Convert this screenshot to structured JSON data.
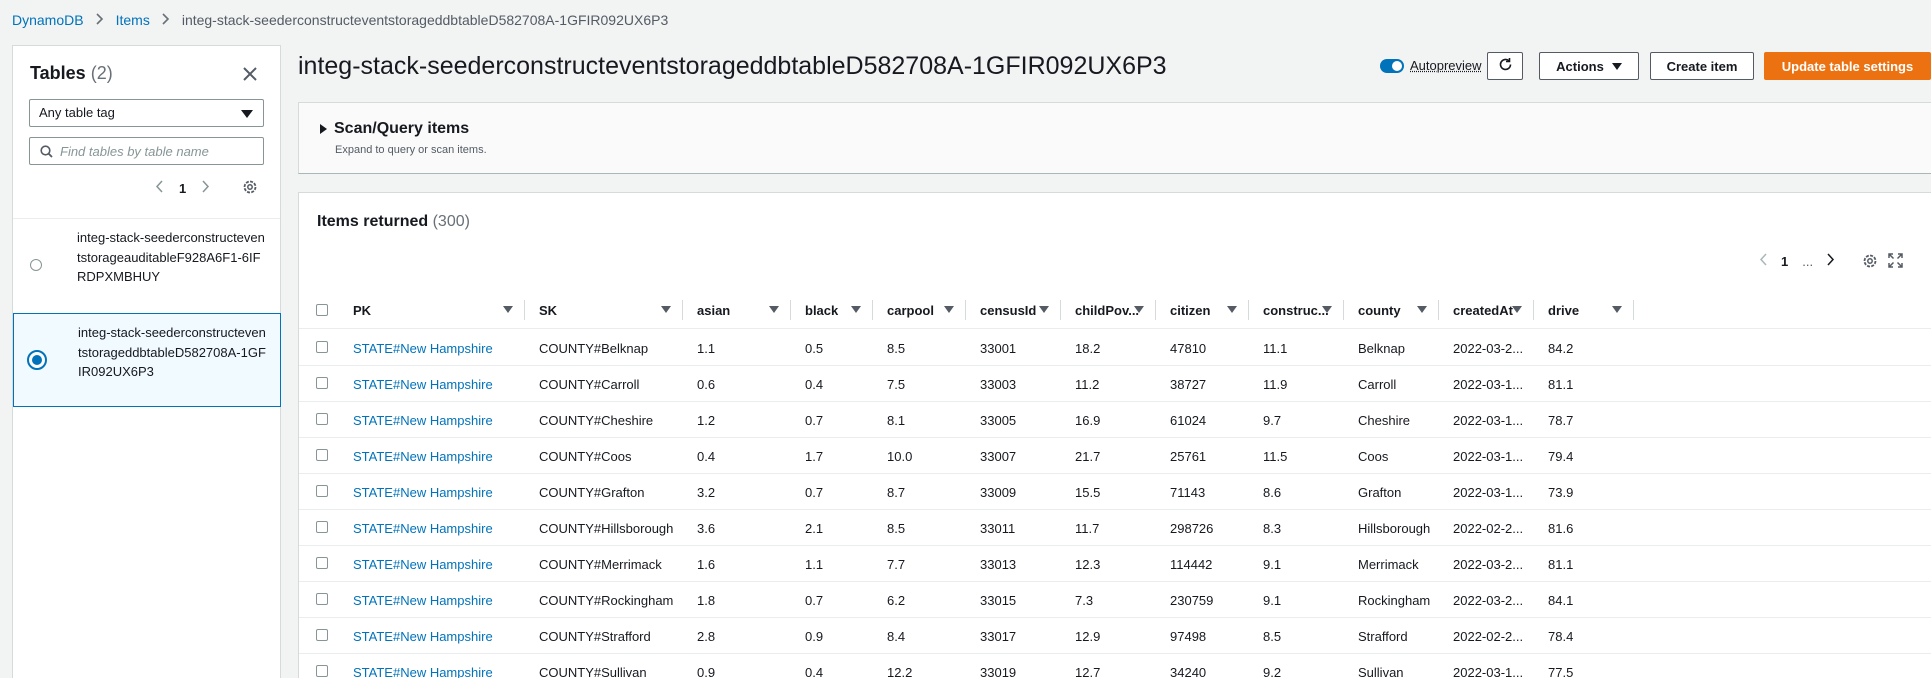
{
  "breadcrumb": {
    "root": "DynamoDB",
    "items": "Items",
    "current": "integ-stack-seederconstructeventstorageddbtableD582708A-1GFIR092UX6P3"
  },
  "sidebar": {
    "title": "Tables",
    "count": "(2)",
    "tag_select": "Any table tag",
    "search_placeholder": "Find tables by table name",
    "page": "1",
    "tables": [
      {
        "name": "integ-stack-seederconstructeventstorageauditableF928A6F1-6IFRDPXMBHUY",
        "selected": false
      },
      {
        "name": "integ-stack-seederconstructeventstorageddbtableD582708A-1GFIR092UX6P3",
        "selected": true
      }
    ]
  },
  "header": {
    "title": "integ-stack-seederconstructeventstorageddbtableD582708A-1GFIR092UX6P3",
    "autopreview_label": "Autopreview",
    "actions_label": "Actions",
    "create_item_label": "Create item",
    "update_settings_label": "Update table settings"
  },
  "scan": {
    "title": "Scan/Query items",
    "description": "Expand to query or scan items."
  },
  "items": {
    "title": "Items returned",
    "count": "(300)",
    "page": "1",
    "ellipsis": "...",
    "columns": [
      "PK",
      "SK",
      "asian",
      "black",
      "carpool",
      "censusId",
      "childPov...",
      "citizen",
      "construc...",
      "county",
      "createdAt",
      "drive"
    ],
    "rows": [
      [
        "STATE#New Hampshire",
        "COUNTY#Belknap",
        "1.1",
        "0.5",
        "8.5",
        "33001",
        "18.2",
        "47810",
        "11.1",
        "Belknap",
        "2022-03-2...",
        "84.2"
      ],
      [
        "STATE#New Hampshire",
        "COUNTY#Carroll",
        "0.6",
        "0.4",
        "7.5",
        "33003",
        "11.2",
        "38727",
        "11.9",
        "Carroll",
        "2022-03-1...",
        "81.1"
      ],
      [
        "STATE#New Hampshire",
        "COUNTY#Cheshire",
        "1.2",
        "0.7",
        "8.1",
        "33005",
        "16.9",
        "61024",
        "9.7",
        "Cheshire",
        "2022-03-1...",
        "78.7"
      ],
      [
        "STATE#New Hampshire",
        "COUNTY#Coos",
        "0.4",
        "1.7",
        "10.0",
        "33007",
        "21.7",
        "25761",
        "11.5",
        "Coos",
        "2022-03-1...",
        "79.4"
      ],
      [
        "STATE#New Hampshire",
        "COUNTY#Grafton",
        "3.2",
        "0.7",
        "8.7",
        "33009",
        "15.5",
        "71143",
        "8.6",
        "Grafton",
        "2022-03-1...",
        "73.9"
      ],
      [
        "STATE#New Hampshire",
        "COUNTY#Hillsborough",
        "3.6",
        "2.1",
        "8.5",
        "33011",
        "11.7",
        "298726",
        "8.3",
        "Hillsborough",
        "2022-02-2...",
        "81.6"
      ],
      [
        "STATE#New Hampshire",
        "COUNTY#Merrimack",
        "1.6",
        "1.1",
        "7.7",
        "33013",
        "12.3",
        "114442",
        "9.1",
        "Merrimack",
        "2022-03-2...",
        "81.1"
      ],
      [
        "STATE#New Hampshire",
        "COUNTY#Rockingham",
        "1.8",
        "0.7",
        "6.2",
        "33015",
        "7.3",
        "230759",
        "9.1",
        "Rockingham",
        "2022-03-2...",
        "84.1"
      ],
      [
        "STATE#New Hampshire",
        "COUNTY#Strafford",
        "2.8",
        "0.9",
        "8.4",
        "33017",
        "12.9",
        "97498",
        "8.5",
        "Strafford",
        "2022-02-2...",
        "78.4"
      ],
      [
        "STATE#New Hampshire",
        "COUNTY#Sullivan",
        "0.9",
        "0.4",
        "12.2",
        "33019",
        "12.7",
        "34240",
        "9.2",
        "Sullivan",
        "2022-03-1...",
        "77.5"
      ]
    ]
  },
  "colors": {
    "link": "#0073bb",
    "primary": "#ec7211",
    "border": "#d5dbdb"
  },
  "icons": [
    "chevron-right-icon",
    "close-icon",
    "search-icon",
    "settings-icon",
    "refresh-icon",
    "fullscreen-icon",
    "caret-down-icon"
  ]
}
